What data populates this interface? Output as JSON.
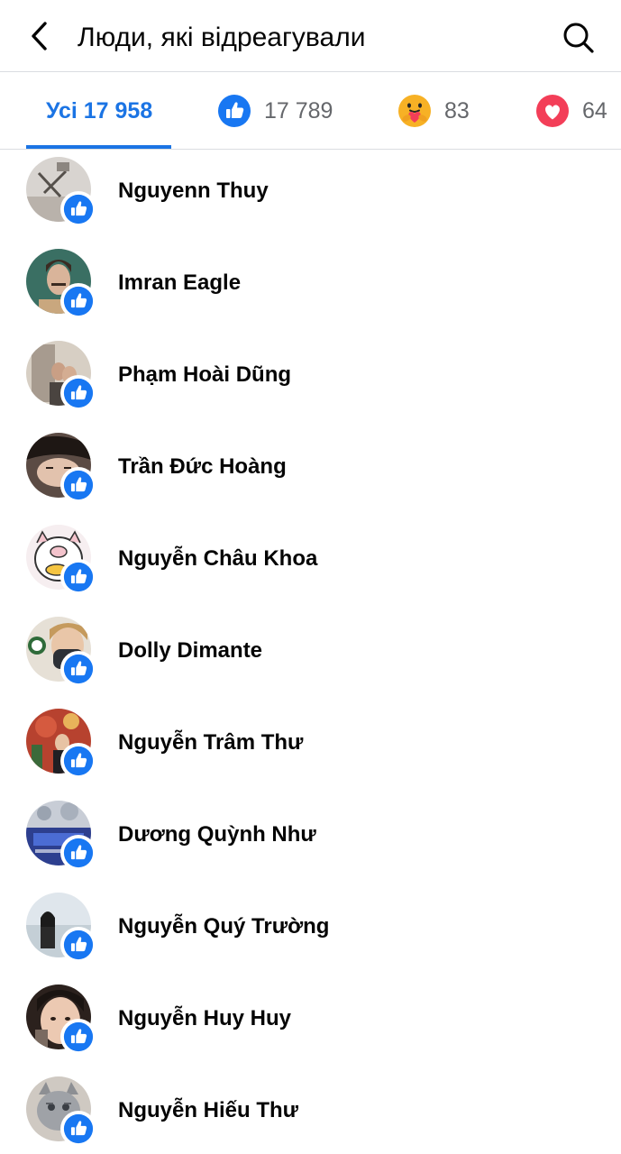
{
  "header": {
    "title": "Люди, які відреагували",
    "back_icon": "chevron-left-icon",
    "search_icon": "search-icon"
  },
  "tabs": [
    {
      "label": "Усі 17 958",
      "active": true
    },
    {
      "icon": "like-reaction-icon",
      "count": "17 789"
    },
    {
      "icon": "care-reaction-icon",
      "count": "83"
    },
    {
      "icon": "love-reaction-icon",
      "count": "64"
    }
  ],
  "colors": {
    "accent": "#1b74e4",
    "like": "#1877f2",
    "love": "#f33e58",
    "care": "#f7b125",
    "text": "#050505",
    "secondary_text": "#65676b",
    "divider": "#dadde1"
  },
  "people": [
    {
      "name": "Nguyenn Thuy",
      "reaction": "like-reaction-icon"
    },
    {
      "name": "Imran Eagle",
      "reaction": "like-reaction-icon"
    },
    {
      "name": "Phạm Hoài Dũng",
      "reaction": "like-reaction-icon"
    },
    {
      "name": "Trần Đức Hoàng",
      "reaction": "like-reaction-icon"
    },
    {
      "name": "Nguyễn Châu Khoa",
      "reaction": "like-reaction-icon"
    },
    {
      "name": "Dolly Dimante",
      "reaction": "like-reaction-icon"
    },
    {
      "name": "Nguyễn Trâm Thư",
      "reaction": "like-reaction-icon"
    },
    {
      "name": "Dương Quỳnh Như",
      "reaction": "like-reaction-icon"
    },
    {
      "name": "Nguyễn Quý Trường",
      "reaction": "like-reaction-icon"
    },
    {
      "name": "Nguyễn Huy Huy",
      "reaction": "like-reaction-icon"
    },
    {
      "name": "Nguyễn Hiếu Thư",
      "reaction": "like-reaction-icon"
    }
  ]
}
